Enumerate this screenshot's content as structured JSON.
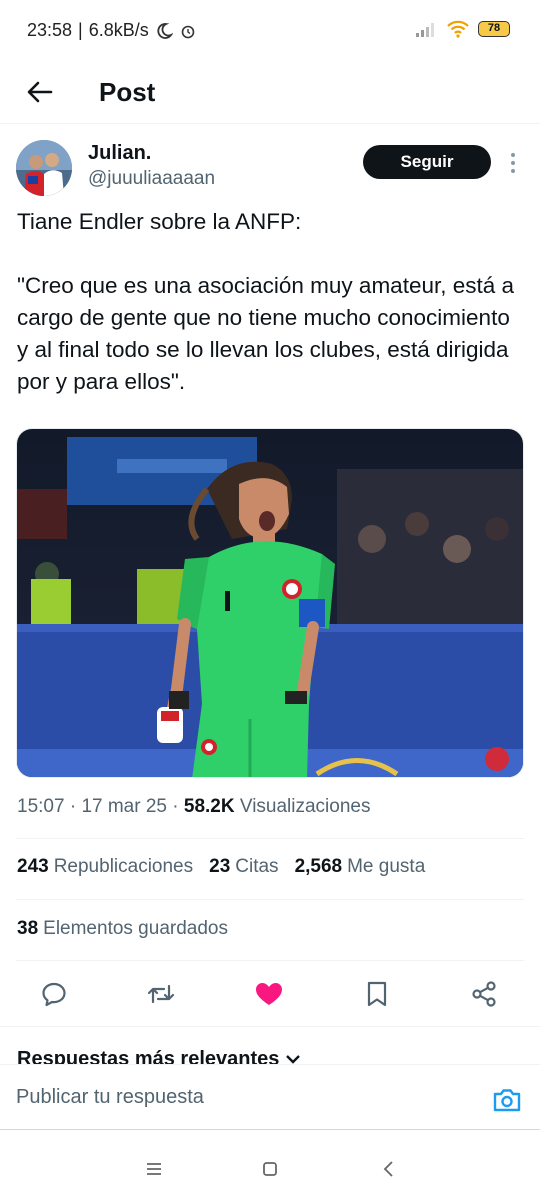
{
  "status_bar": {
    "time": "23:58",
    "speed": "6.8kB/s",
    "battery": "78"
  },
  "header": {
    "title": "Post"
  },
  "author": {
    "name": "Julian.",
    "handle": "@juuuliaaaaan",
    "follow_label": "Seguir"
  },
  "tweet": {
    "line1": "Tiane Endler sobre la ANFP:",
    "quote": "\"Creo que es una asociación muy amateur, está a cargo de gente que no tiene mucho conocimiento y al final todo se lo llevan los clubes, está dirigida por y para ellos\"."
  },
  "meta": {
    "time": "15:07",
    "date": "17 mar 25",
    "views_count": "58.2K",
    "views_label": "Visualizaciones"
  },
  "stats": {
    "reposts_count": "243",
    "reposts_label": "Republicaciones",
    "quotes_count": "23",
    "quotes_label": "Citas",
    "likes_count": "2,568",
    "likes_label": "Me gusta",
    "bookmarks_count": "38",
    "bookmarks_label": "Elementos guardados"
  },
  "replies": {
    "header": "Respuestas más relevantes",
    "placeholder": "Publicar tu respuesta"
  },
  "colors": {
    "like": "#f91880",
    "follow_bg": "#0f1419",
    "secondary_text": "#536471",
    "camera": "#1d9bf0",
    "jersey": "#2fd06a"
  },
  "icons": [
    "back-arrow-icon",
    "more-vertical-icon",
    "reply-icon",
    "repost-icon",
    "heart-icon",
    "bookmark-icon",
    "share-icon",
    "camera-icon",
    "menu-icon",
    "home-icon",
    "back-icon"
  ]
}
